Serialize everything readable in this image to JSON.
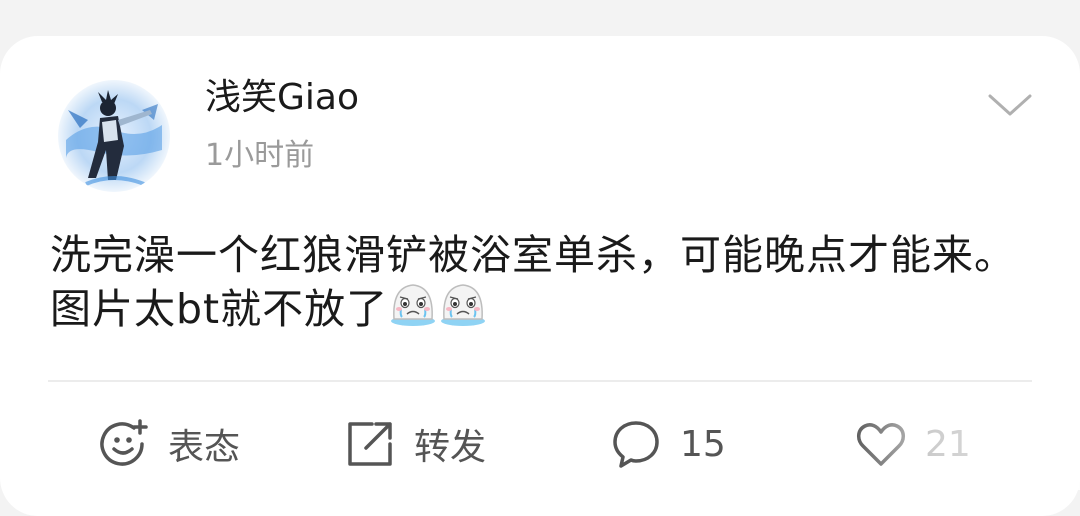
{
  "post": {
    "author": "浅笑Giao",
    "time": "1小时前",
    "text": "洗完澡一个红狼滑铲被浴室单杀，可能晚点才能来。图片太bt就不放了",
    "emojis": [
      "crying-face-emoji",
      "crying-face-emoji"
    ]
  },
  "actions": {
    "react_label": "表态",
    "repost_label": "转发",
    "comment_count": "15",
    "like_count": "21"
  },
  "icons": {
    "menu": "chevron-down-icon",
    "react": "smiley-plus-icon",
    "repost": "share-arrow-icon",
    "comment": "speech-bubble-icon",
    "like": "heart-icon"
  },
  "colors": {
    "background": "#f3f3f3",
    "card": "#ffffff",
    "text": "#1a1a1a",
    "muted": "#9a9a9a",
    "action": "#555555"
  }
}
